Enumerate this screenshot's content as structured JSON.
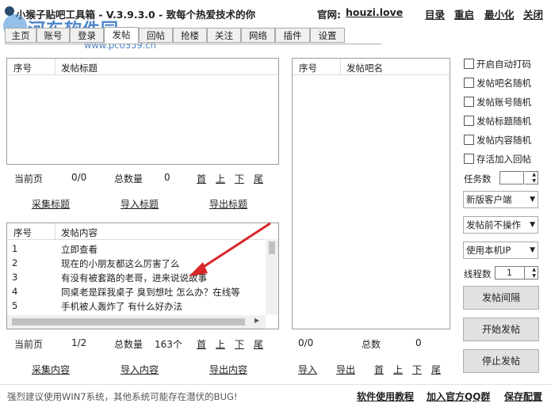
{
  "window": {
    "title": "小猴子贴吧工具箱 - V.3.9.3.0 - 致每个热爱技术的你",
    "site_label": "官网:",
    "site_url": "houzi.love",
    "buttons": [
      "目录",
      "重启",
      "最小化",
      "关闭"
    ]
  },
  "watermark": {
    "text": "河东软件园",
    "url": "www.pc0359.cn"
  },
  "tabs": [
    "主页",
    "账号",
    "登录",
    "发帖",
    "回帖",
    "抢楼",
    "关注",
    "网络",
    "插件",
    "设置"
  ],
  "active_tab": "发帖",
  "title_grid": {
    "col_index": "序号",
    "col_title": "发帖标题",
    "page_label": "当前页",
    "page_value": "0/0",
    "total_label": "总数量",
    "total_value": "0",
    "nav": [
      "首",
      "上",
      "下",
      "尾"
    ],
    "actions": [
      "采集标题",
      "导入标题",
      "导出标题"
    ]
  },
  "content_grid": {
    "col_index": "序号",
    "col_content": "发帖内容",
    "rows": [
      {
        "index": "1",
        "content": "立即查看"
      },
      {
        "index": "2",
        "content": "现在的小朋友都这么厉害了么"
      },
      {
        "index": "3",
        "content": "有没有被套路的老哥，进来说说故事"
      },
      {
        "index": "4",
        "content": "同桌老是踩我桌子 臭到想吐 怎么办？在线等"
      },
      {
        "index": "5",
        "content": "手机被人轰炸了 有什么好办法"
      }
    ],
    "page_label": "当前页",
    "page_value": "1/2",
    "total_label": "总数量",
    "total_value": "163个",
    "nav": [
      "首",
      "上",
      "下",
      "尾"
    ],
    "actions": [
      "采集内容",
      "导入内容",
      "导出内容"
    ]
  },
  "bar_grid": {
    "col_index": "序号",
    "col_name": "发帖吧名",
    "page_value": "0/0",
    "total_label": "总数",
    "total_value": "0",
    "actions": [
      "导入",
      "导出"
    ],
    "nav": [
      "首",
      "上",
      "下",
      "尾"
    ]
  },
  "options": {
    "checkboxes": [
      "开启自动打码",
      "发帖吧名随机",
      "发帖账号随机",
      "发帖标题随机",
      "发帖内容随机",
      "存活加入回帖"
    ],
    "task_label": "任务数",
    "task_value": "",
    "client_select": "新版客户端",
    "pre_post_select": "发帖前不操作",
    "ip_select": "使用本机IP",
    "thread_label": "线程数",
    "thread_value": "1",
    "btn_interval": "发帖间隔",
    "btn_start": "开始发帖",
    "btn_stop": "停止发帖"
  },
  "footer": {
    "notice": "强烈建议使用WIN7系统，其他系统可能存在潜伏的BUG!",
    "links": [
      "软件使用教程",
      "加入官方QQ群",
      "保存配置"
    ]
  },
  "colors": {
    "watermark": "#2e6fc0",
    "arrow": "#d9262a"
  }
}
